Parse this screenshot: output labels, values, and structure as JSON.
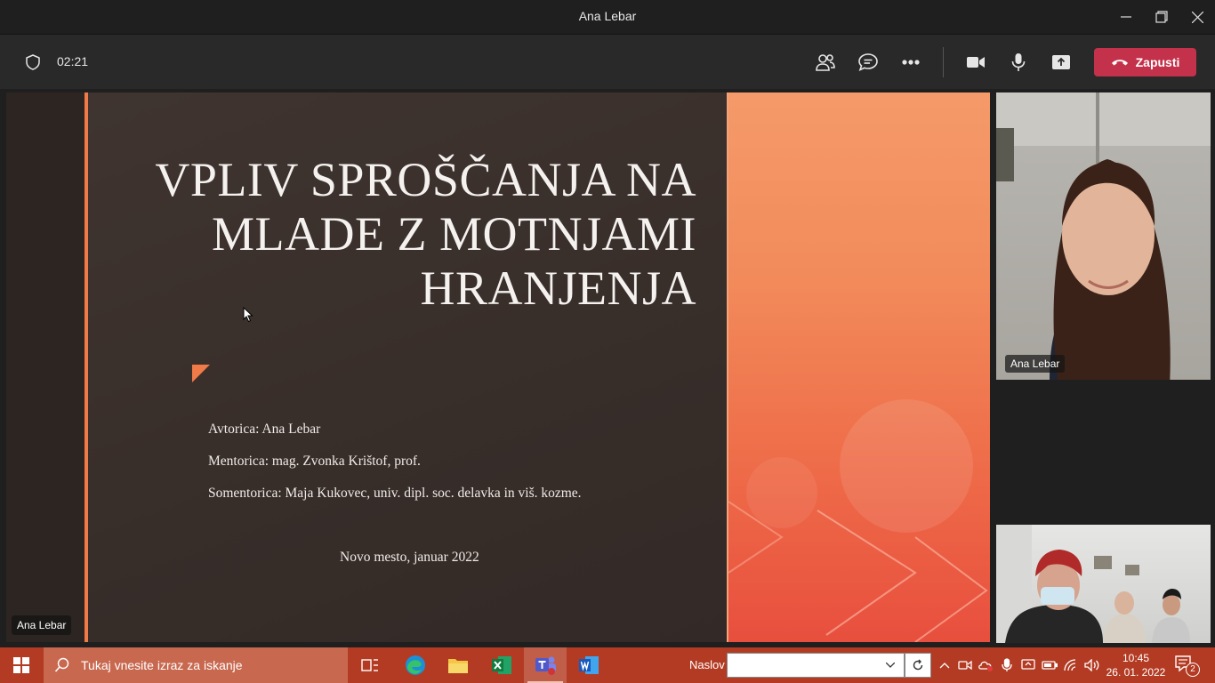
{
  "window": {
    "title": "Ana Lebar"
  },
  "toolbar": {
    "timer": "02:21",
    "leave_label": "Zapusti"
  },
  "slide": {
    "title_lines": [
      "VPLIV SPROŠČANJA NA",
      "MLADE Z MOTNJAMI",
      "HRANJENJA"
    ],
    "author": "Avtorica: Ana Lebar",
    "mentor": "Mentorica: mag. Zvonka Krištof, prof.",
    "co_mentor": "Somentorica: Maja Kukovec, univ. dipl. soc. delavka in viš. kozme.",
    "place_date": "Novo mesto, januar 2022"
  },
  "presenter_tag": "Ana Lebar",
  "participants": [
    {
      "name": "Ana Lebar"
    }
  ],
  "taskbar": {
    "search_placeholder": "Tukaj vnesite izraz za iskanje",
    "address_label": "Naslov",
    "address_value": "",
    "time": "10:45",
    "date": "26. 01. 2022",
    "notification_count": "2"
  }
}
